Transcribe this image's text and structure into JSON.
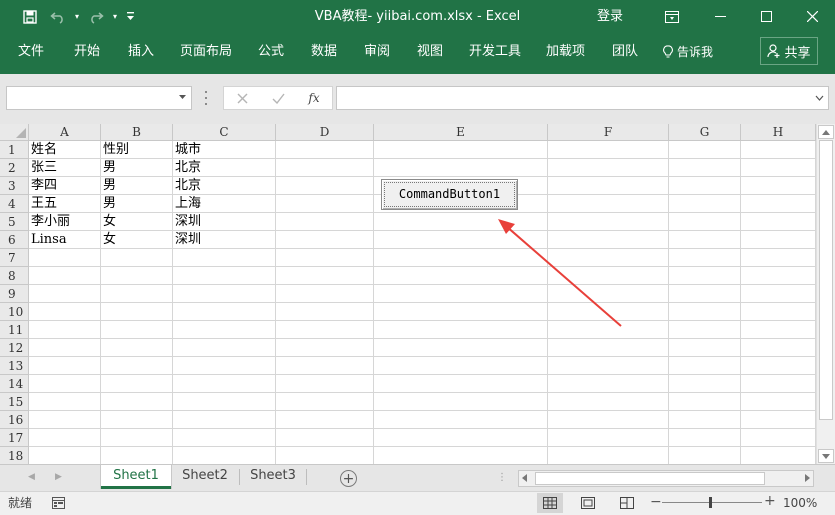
{
  "titlebar": {
    "title": "VBA教程- yiibai.com.xlsx - Excel",
    "login_label": "登录",
    "colors": {
      "accent": "#217346"
    }
  },
  "quick_access": {
    "icons": [
      "save-icon",
      "undo-icon",
      "redo-icon",
      "customize-icon"
    ]
  },
  "ribbon": {
    "tabs": [
      "文件",
      "开始",
      "插入",
      "页面布局",
      "公式",
      "数据",
      "审阅",
      "视图",
      "开发工具",
      "加载项",
      "团队"
    ],
    "tell_me": "告诉我",
    "share": "共享"
  },
  "formula_bar": {
    "name_box": "",
    "formula": "",
    "fx_label": "fx"
  },
  "grid": {
    "columns": [
      "A",
      "B",
      "C",
      "D",
      "E",
      "F",
      "G",
      "H"
    ],
    "rows": [
      "1",
      "2",
      "3",
      "4",
      "5",
      "6",
      "7",
      "8",
      "9",
      "10",
      "11",
      "12",
      "13",
      "14",
      "15",
      "16",
      "17",
      "18"
    ],
    "data": [
      [
        "姓名",
        "性别",
        "城市"
      ],
      [
        "张三",
        "男",
        "北京"
      ],
      [
        "李四",
        "男",
        "北京"
      ],
      [
        "王五",
        "男",
        "上海"
      ],
      [
        "李小丽",
        "女",
        "深圳"
      ],
      [
        "Linsa",
        "女",
        "深圳"
      ]
    ]
  },
  "command_button": {
    "label": "CommandButton1"
  },
  "sheets": {
    "tabs": [
      "Sheet1",
      "Sheet2",
      "Sheet3"
    ],
    "active": "Sheet1"
  },
  "statusbar": {
    "ready": "就绪",
    "zoom": "100%"
  }
}
